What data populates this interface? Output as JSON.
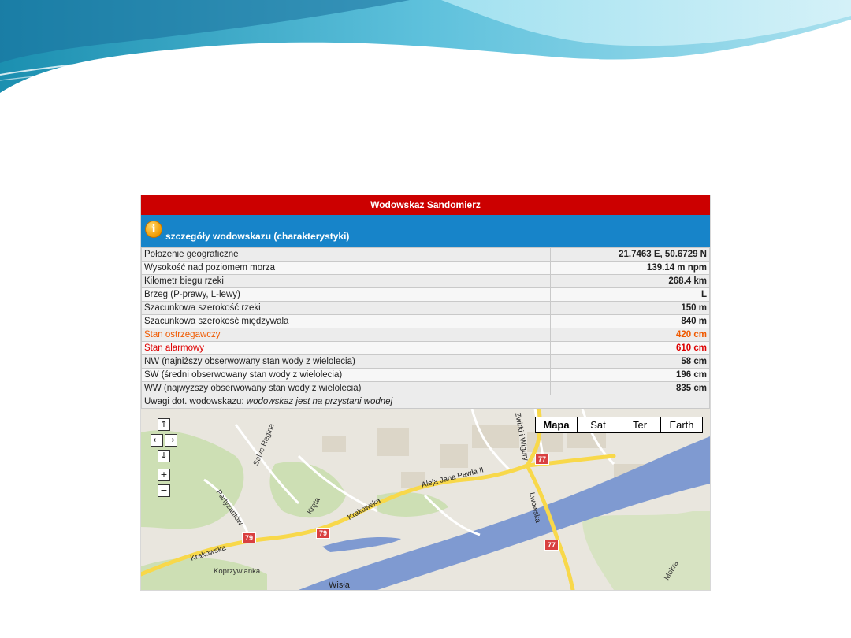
{
  "station": {
    "title": "Wodowskaz Sandomierz",
    "subtitle": "szczegóły wodowskazu (charakterystyki)",
    "rows": [
      {
        "label": "Położenie geograficzne",
        "value": "21.7463 E, 50.6729 N",
        "kind": "normal"
      },
      {
        "label": "Wysokość nad poziomem morza",
        "value": "139.14 m npm",
        "kind": "normal"
      },
      {
        "label": "Kilometr biegu rzeki",
        "value": "268.4 km",
        "kind": "normal"
      },
      {
        "label": "Brzeg (P-prawy, L-lewy)",
        "value": "L",
        "kind": "normal"
      },
      {
        "label": "Szacunkowa szerokość rzeki",
        "value": "150 m",
        "kind": "normal"
      },
      {
        "label": "Szacunkowa szerokość międzywala",
        "value": "840 m",
        "kind": "normal"
      },
      {
        "label": "Stan ostrzegawczy",
        "value": "420 cm",
        "kind": "warn"
      },
      {
        "label": "Stan alarmowy",
        "value": "610 cm",
        "kind": "alarm"
      },
      {
        "label": "NW (najniższy obserwowany stan wody z wielolecia)",
        "value": "58 cm",
        "kind": "normal"
      },
      {
        "label": "SW (średni obserwowany stan wody z wielolecia)",
        "value": "196 cm",
        "kind": "normal"
      },
      {
        "label": "WW (najwyższy obserwowany stan wody z wielolecia)",
        "value": "835 cm",
        "kind": "normal"
      }
    ],
    "remark_label": "Uwagi dot. wodowskazu:",
    "remark_text": "wodowskaz jest na przystani wodnej",
    "colors": {
      "title_bg": "#cc0000",
      "subtitle_bg": "#1784c9",
      "warn": "#f05a00",
      "alarm": "#dd0000"
    }
  },
  "map": {
    "types": [
      "Mapa",
      "Sat",
      "Ter",
      "Earth"
    ],
    "selected_type": "Mapa",
    "controls": {
      "pan_up": "↑",
      "pan_left": "←",
      "pan_right": "→",
      "pan_down": "↓",
      "zoom_in": "+",
      "zoom_out": "−"
    },
    "labels": {
      "aleja": "Aleja Jana Pawła II",
      "krakowska": "Krakowska",
      "krakowska2": "Krakowska",
      "zwirki": "Żwirki i Wigury",
      "lwowska": "Lwowska",
      "salve": "Salve Regina",
      "partyzantow": "Partyzantów",
      "kreta": "Kręta",
      "koprzywianka": "Koprzywianka",
      "wisla": "Wisła",
      "mokra": "Mokra"
    },
    "road_numbers": {
      "r77a": "77",
      "r77b": "77",
      "r79a": "79",
      "r79b": "79"
    },
    "colors": {
      "land": "#e9e6de",
      "green": "#cddfb4",
      "river": "#7f9ad1",
      "road_major": "#f8d84a",
      "road_minor": "#ffffff"
    }
  }
}
